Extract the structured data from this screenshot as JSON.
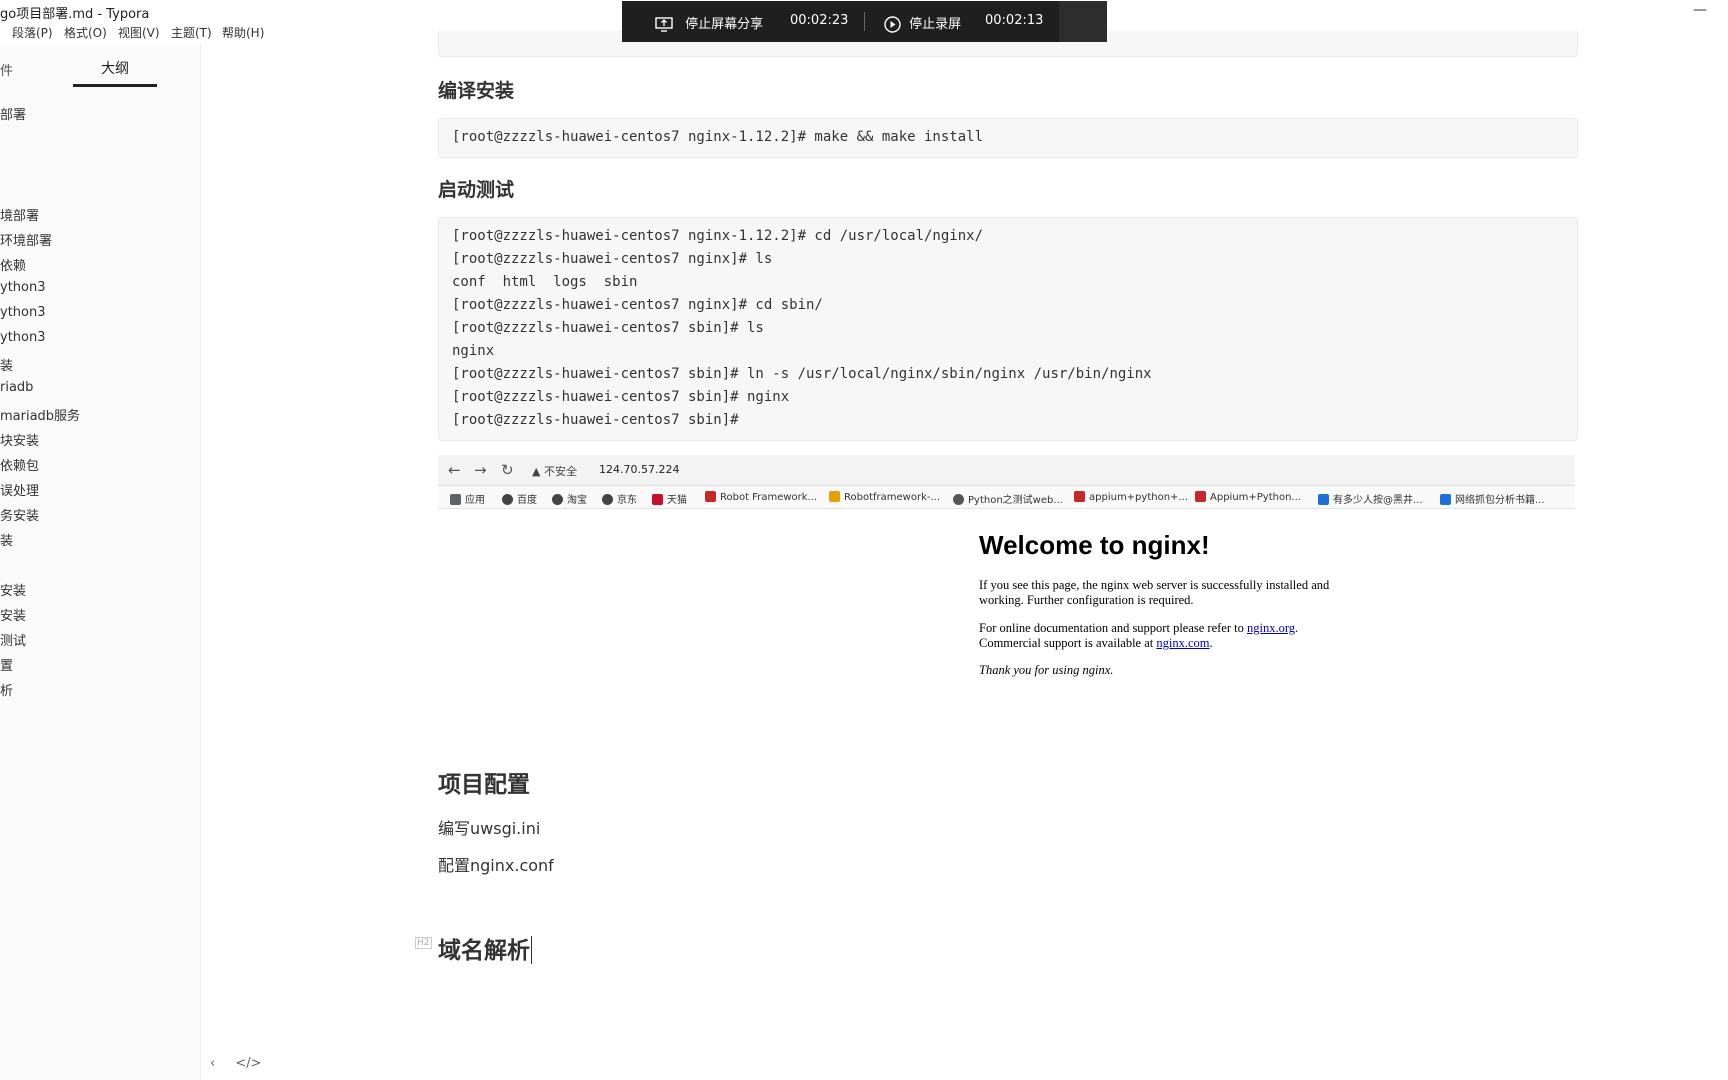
{
  "window": {
    "title": "go项目部署.md - Typora",
    "minimize_glyph": "—"
  },
  "menubar": {
    "items": [
      "段落(P)",
      "格式(O)",
      "视图(V)",
      "主题(T)",
      "帮助(H)"
    ]
  },
  "recording_bar": {
    "stop_share_label": "停止屏幕分享",
    "share_time": "00:02:23",
    "stop_record_label": "停止录屏",
    "record_time": "00:02:13"
  },
  "sidebar": {
    "tab_files": "件",
    "tab_outline": "大纲",
    "outline_items": [
      "部署",
      "境部署",
      "环境部署",
      "依赖",
      "ython3",
      "ython3",
      "ython3",
      "装",
      "riadb",
      "mariadb服务",
      "块安装",
      "依赖包",
      "误处理",
      "务安装",
      "装",
      "安装",
      "安装",
      "测试",
      "置",
      "析"
    ],
    "bottom_left_glyph": "‹",
    "bottom_code_glyph": "</>"
  },
  "editor": {
    "sec_compile": "编译安装",
    "code_compile": [
      "[root@zzzzls-huawei-centos7 nginx-1.12.2]# make && make install"
    ],
    "sec_start_test": "启动测试",
    "code_start_test": [
      "[root@zzzzls-huawei-centos7 nginx-1.12.2]# cd /usr/local/nginx/",
      "[root@zzzzls-huawei-centos7 nginx]# ls",
      "conf  html  logs  sbin",
      "[root@zzzzls-huawei-centos7 nginx]# cd sbin/",
      "[root@zzzzls-huawei-centos7 sbin]# ls",
      "nginx",
      "[root@zzzzls-huawei-centos7 sbin]# ln -s /usr/local/nginx/sbin/nginx /usr/bin/nginx",
      "[root@zzzzls-huawei-centos7 sbin]# nginx",
      "[root@zzzzls-huawei-centos7 sbin]#"
    ],
    "sec_project_config": "项目配置",
    "para_uwsgi": "编写uwsgi.ini",
    "para_nginx_conf": "配置nginx.conf",
    "sec_dns": "域名解析",
    "h_marker": "H2"
  },
  "embedded_browser": {
    "back": "←",
    "forward": "→",
    "reload": "↻",
    "insecure_label": "▲ 不安全",
    "url": "124.70.57.224",
    "bookmarks": [
      {
        "label": "应用",
        "color": "#5f6368"
      },
      {
        "label": "百度",
        "color": "#444444"
      },
      {
        "label": "淘宝",
        "color": "#444444"
      },
      {
        "label": "京东",
        "color": "#444444"
      },
      {
        "label": "天猫",
        "color": "#c8102e"
      },
      {
        "label": "Robot Framework...",
        "color": "#c62828"
      },
      {
        "label": "Robotframework-...",
        "color": "#e6a100"
      },
      {
        "label": "Python之测试web...",
        "color": "#555555"
      },
      {
        "label": "appium+python+...",
        "color": "#c62828"
      },
      {
        "label": "Appium+Python...",
        "color": "#c62828"
      },
      {
        "label": "有多少人按@黑井...",
        "color": "#1e6fd9"
      },
      {
        "label": "网络抓包分析书籍...",
        "color": "#1e6fd9"
      }
    ],
    "page": {
      "title": "Welcome to nginx!",
      "p1": "If you see this page, the nginx web server is successfully installed and",
      "p1b": "working. Further configuration is required.",
      "p2": "For online documentation and support please refer to ",
      "link1": "nginx.org",
      "p2_end": ".",
      "p3": "Commercial support is available at ",
      "link2": "nginx.com",
      "p3_end": ".",
      "thanks": "Thank you for using nginx."
    }
  }
}
